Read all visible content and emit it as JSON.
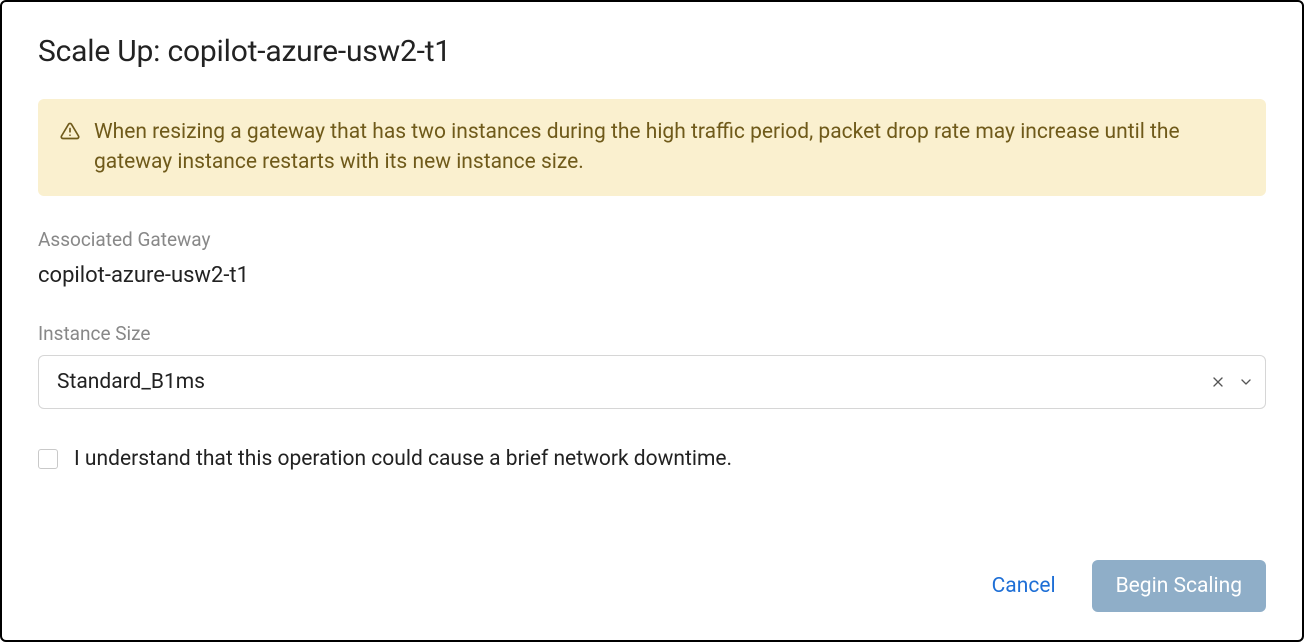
{
  "dialog": {
    "title": "Scale Up: copilot-azure-usw2-t1"
  },
  "alert": {
    "message": "When resizing a gateway that has two instances during the high traffic period, packet drop rate may increase until the gateway instance restarts with its new instance size."
  },
  "fields": {
    "associated_gateway": {
      "label": "Associated Gateway",
      "value": "copilot-azure-usw2-t1"
    },
    "instance_size": {
      "label": "Instance Size",
      "selected": "Standard_B1ms"
    }
  },
  "checkbox": {
    "label": "I understand that this operation could cause a brief network downtime.",
    "checked": false
  },
  "buttons": {
    "cancel": "Cancel",
    "begin_scaling": "Begin Scaling"
  }
}
